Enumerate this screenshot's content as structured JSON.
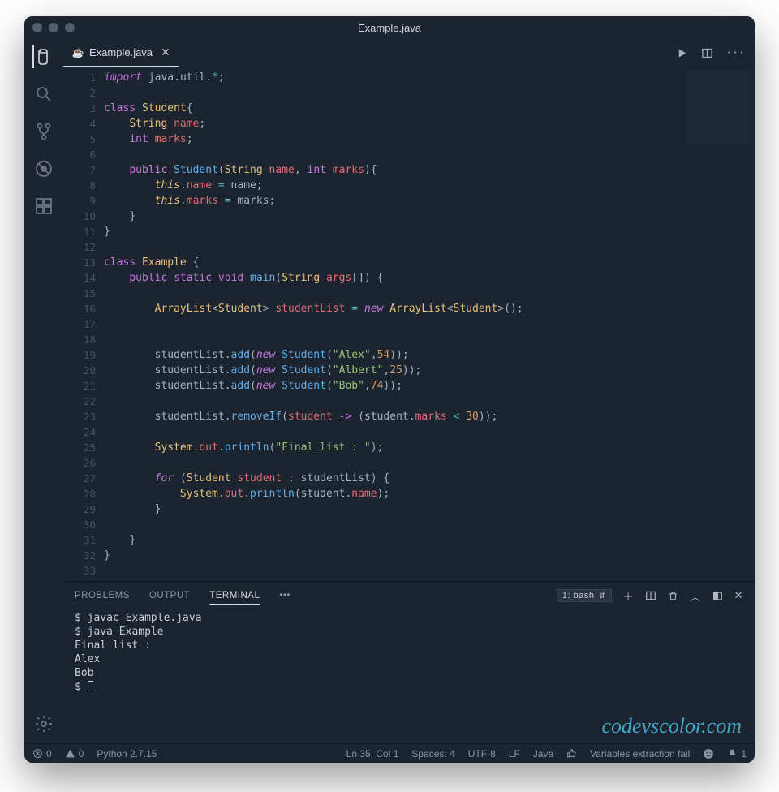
{
  "window": {
    "title": "Example.java"
  },
  "tab": {
    "label": "Example.java"
  },
  "actions": {
    "run": "▶",
    "split": "⊞",
    "more": "···"
  },
  "code": {
    "lines": [
      {
        "n": 1,
        "html": "<span class='tok-kw2'>import</span> <span class='tok-pkg'>java</span><span class='tok-punc'>.</span><span class='tok-pkg'>util</span><span class='tok-punc'>.</span><span class='tok-op'>*</span><span class='tok-punc'>;</span>"
      },
      {
        "n": 2,
        "html": ""
      },
      {
        "n": 3,
        "html": "<span class='tok-kw'>class</span> <span class='tok-type'>Student</span><span class='tok-punc'>{</span>"
      },
      {
        "n": 4,
        "html": "    <span class='tok-builtin'>String</span> <span class='tok-var'>name</span><span class='tok-punc'>;</span>"
      },
      {
        "n": 5,
        "html": "    <span class='tok-kw'>int</span> <span class='tok-var'>marks</span><span class='tok-punc'>;</span>"
      },
      {
        "n": 6,
        "html": ""
      },
      {
        "n": 7,
        "html": "    <span class='tok-kw'>public</span> <span class='tok-fn'>Student</span><span class='tok-punc'>(</span><span class='tok-builtin'>String</span> <span class='tok-var'>name</span><span class='tok-punc'>,</span> <span class='tok-kw'>int</span> <span class='tok-var'>marks</span><span class='tok-punc'>){</span>"
      },
      {
        "n": 8,
        "html": "        <span class='tok-this'>this</span><span class='tok-punc'>.</span><span class='tok-var'>name</span> <span class='tok-op'>=</span> name<span class='tok-punc'>;</span>"
      },
      {
        "n": 9,
        "html": "        <span class='tok-this'>this</span><span class='tok-punc'>.</span><span class='tok-var'>marks</span> <span class='tok-op'>=</span> marks<span class='tok-punc'>;</span>"
      },
      {
        "n": 10,
        "html": "    <span class='tok-punc'>}</span>"
      },
      {
        "n": 11,
        "html": "<span class='tok-punc'>}</span>"
      },
      {
        "n": 12,
        "html": ""
      },
      {
        "n": 13,
        "html": "<span class='tok-kw'>class</span> <span class='tok-type'>Example</span> <span class='tok-punc'>{</span>"
      },
      {
        "n": 14,
        "html": "    <span class='tok-kw'>public</span> <span class='tok-kw'>static</span> <span class='tok-kw'>void</span> <span class='tok-fn'>main</span><span class='tok-punc'>(</span><span class='tok-builtin'>String</span> <span class='tok-var'>args</span><span class='tok-punc'>[]) {</span>"
      },
      {
        "n": 15,
        "html": ""
      },
      {
        "n": 16,
        "html": "        <span class='tok-builtin'>ArrayList</span><span class='tok-punc'>&lt;</span><span class='tok-builtin'>Student</span><span class='tok-punc'>&gt;</span> <span class='tok-var'>studentList</span> <span class='tok-op'>=</span> <span class='tok-new'>new</span> <span class='tok-builtin'>ArrayList</span><span class='tok-punc'>&lt;</span><span class='tok-builtin'>Student</span><span class='tok-punc'>&gt;();</span>"
      },
      {
        "n": 17,
        "html": ""
      },
      {
        "n": 18,
        "html": ""
      },
      {
        "n": 19,
        "html": "        studentList<span class='tok-punc'>.</span><span class='tok-fn'>add</span><span class='tok-punc'>(</span><span class='tok-new'>new</span> <span class='tok-fn'>Student</span><span class='tok-punc'>(</span><span class='tok-str'>\"Alex\"</span><span class='tok-punc'>,</span><span class='tok-num'>54</span><span class='tok-punc'>));</span>"
      },
      {
        "n": 20,
        "html": "        studentList<span class='tok-punc'>.</span><span class='tok-fn'>add</span><span class='tok-punc'>(</span><span class='tok-new'>new</span> <span class='tok-fn'>Student</span><span class='tok-punc'>(</span><span class='tok-str'>\"Albert\"</span><span class='tok-punc'>,</span><span class='tok-num'>25</span><span class='tok-punc'>));</span>"
      },
      {
        "n": 21,
        "html": "        studentList<span class='tok-punc'>.</span><span class='tok-fn'>add</span><span class='tok-punc'>(</span><span class='tok-new'>new</span> <span class='tok-fn'>Student</span><span class='tok-punc'>(</span><span class='tok-str'>\"Bob\"</span><span class='tok-punc'>,</span><span class='tok-num'>74</span><span class='tok-punc'>));</span>"
      },
      {
        "n": 22,
        "html": ""
      },
      {
        "n": 23,
        "html": "        studentList<span class='tok-punc'>.</span><span class='tok-fn'>removeIf</span><span class='tok-punc'>(</span><span class='tok-var'>student</span> <span class='tok-kw'>-&gt;</span> <span class='tok-punc'>(</span>student<span class='tok-punc'>.</span><span class='tok-var'>marks</span> <span class='tok-op'>&lt;</span> <span class='tok-num'>30</span><span class='tok-punc'>));</span>"
      },
      {
        "n": 24,
        "html": ""
      },
      {
        "n": 25,
        "html": "        <span class='tok-builtin'>System</span><span class='tok-punc'>.</span><span class='tok-var'>out</span><span class='tok-punc'>.</span><span class='tok-fn'>println</span><span class='tok-punc'>(</span><span class='tok-str'>\"Final list : \"</span><span class='tok-punc'>);</span>"
      },
      {
        "n": 26,
        "html": ""
      },
      {
        "n": 27,
        "html": "        <span class='tok-kw2'>for</span> <span class='tok-punc'>(</span><span class='tok-builtin'>Student</span> <span class='tok-var'>student</span> <span class='tok-op'>:</span> studentList<span class='tok-punc'>) {</span>"
      },
      {
        "n": 28,
        "html": "            <span class='tok-builtin'>System</span><span class='tok-punc'>.</span><span class='tok-var'>out</span><span class='tok-punc'>.</span><span class='tok-fn'>println</span><span class='tok-punc'>(</span>student<span class='tok-punc'>.</span><span class='tok-var'>name</span><span class='tok-punc'>);</span>"
      },
      {
        "n": 29,
        "html": "        <span class='tok-punc'>}</span>"
      },
      {
        "n": 30,
        "html": ""
      },
      {
        "n": 31,
        "html": "    <span class='tok-punc'>}</span>"
      },
      {
        "n": 32,
        "html": "<span class='tok-punc'>}</span>"
      },
      {
        "n": 33,
        "html": ""
      }
    ]
  },
  "panel": {
    "tabs": {
      "problems": "PROBLEMS",
      "output": "OUTPUT",
      "terminal": "TERMINAL"
    },
    "more": "•••",
    "terminal_selector": "1: bash",
    "terminal_lines": [
      "$ javac Example.java",
      "$ java Example",
      "Final list :",
      "Alex",
      "Bob"
    ],
    "prompt": "$ "
  },
  "watermark": "codevscolor.com",
  "status": {
    "errors": "0",
    "warnings": "0",
    "python": "Python 2.7.15",
    "cursor": "Ln 35, Col 1",
    "spaces": "Spaces: 4",
    "encoding": "UTF-8",
    "eol": "LF",
    "lang": "Java",
    "msg": "Variables extraction fail",
    "bell": "1"
  }
}
